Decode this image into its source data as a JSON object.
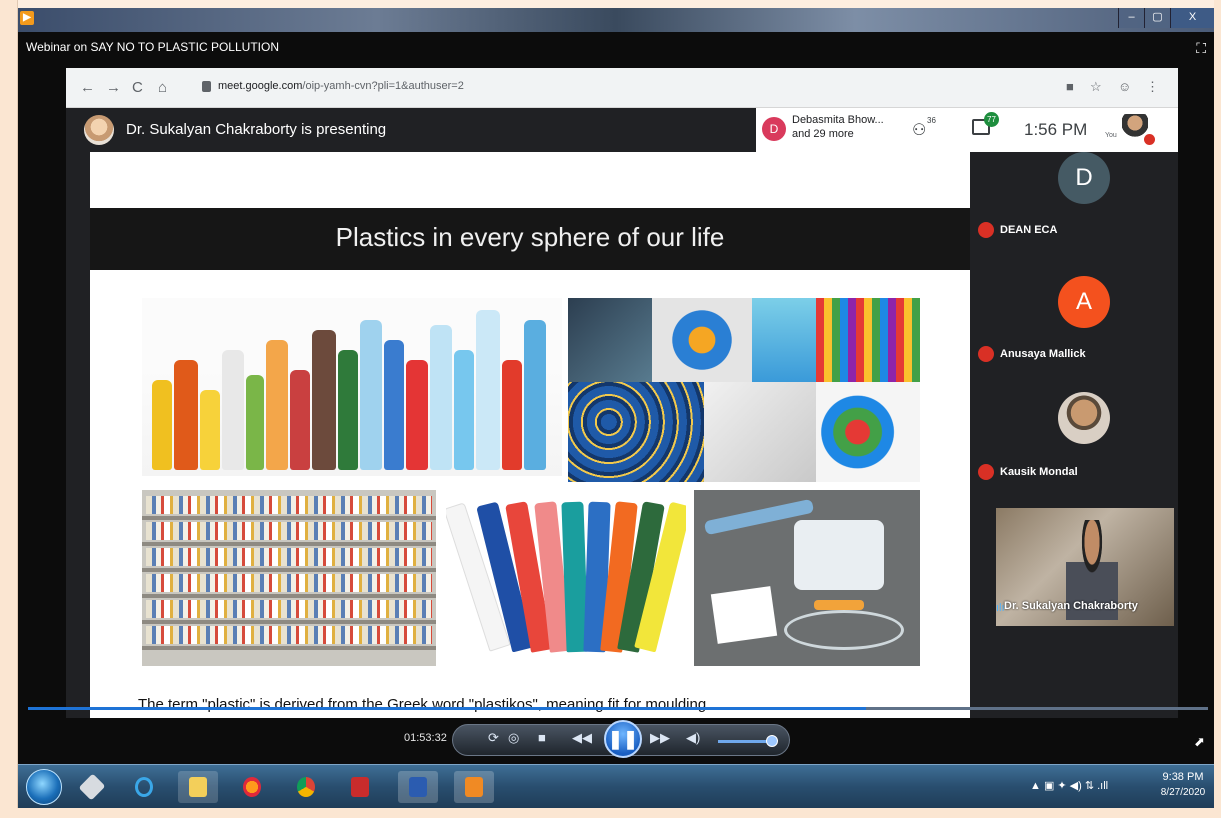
{
  "window": {
    "title": "Webinar on SAY NO TO PLASTIC POLLUTION",
    "buttons": {
      "minimize": "–",
      "maximize": "▢",
      "close": "X"
    }
  },
  "browser": {
    "url_host": "meet.google.com",
    "url_path": "/oip-yamh-cvn?pli=1&authuser=2"
  },
  "meet": {
    "presenting_text": "Dr. Sukalyan Chakraborty is presenting",
    "participant_initial": "D",
    "participant_summary_line1": "Debasmita Bhow...",
    "participant_summary_line2": "and 29 more",
    "people_count": "36",
    "chat_count": "77",
    "clock": "1:56 PM",
    "you_label": "You"
  },
  "slide": {
    "title": "Plastics in every sphere of our life",
    "caption": "The term \"plastic\" is derived from the Greek word \"plastikos\", meaning fit for moulding"
  },
  "participants": [
    {
      "initial": "D",
      "name": "DEAN ECA",
      "color": "#455a64"
    },
    {
      "initial": "A",
      "name": "Anusaya Mallick",
      "color": "#f4511e"
    },
    {
      "initial": "",
      "name": "Kausik Mondal",
      "color": "#8d6e63"
    }
  ],
  "camera": {
    "name": "Dr. Sukalyan Chakraborty"
  },
  "player": {
    "time": "01:53:32",
    "progress": 0.71,
    "volume": 0.9
  },
  "taskbar": {
    "time": "9:38 PM",
    "date": "8/27/2020",
    "icons": [
      "start-orb",
      "pinned-icon",
      "internet-explorer-icon",
      "file-explorer-icon",
      "firefox-icon",
      "chrome-icon",
      "app-icon",
      "word-icon",
      "media-player-icon"
    ]
  }
}
